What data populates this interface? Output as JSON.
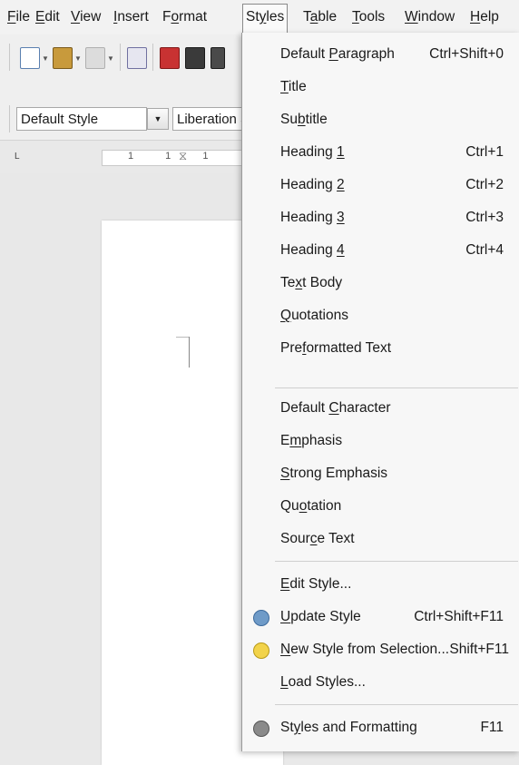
{
  "menubar": {
    "items": [
      {
        "pre": "",
        "u": "F",
        "post": "ile"
      },
      {
        "pre": "",
        "u": "E",
        "post": "dit"
      },
      {
        "pre": "",
        "u": "V",
        "post": "iew"
      },
      {
        "pre": "",
        "u": "I",
        "post": "nsert"
      },
      {
        "pre": "F",
        "u": "o",
        "post": "rmat"
      },
      {
        "pre": "St",
        "u": "y",
        "post": "les"
      },
      {
        "pre": "T",
        "u": "a",
        "post": "ble"
      },
      {
        "pre": "",
        "u": "T",
        "post": "ools"
      },
      {
        "pre": "",
        "u": "W",
        "post": "indow"
      },
      {
        "pre": "",
        "u": "H",
        "post": "elp"
      }
    ]
  },
  "toolbar": {
    "paragraph_style": "Default Style",
    "font_name": "Liberation S"
  },
  "ruler": {
    "marks": "1  1  1"
  },
  "styles_menu": {
    "items": [
      {
        "pre": "Default ",
        "u": "P",
        "post": "aragraph",
        "accel": "Ctrl+Shift+0",
        "icon": ""
      },
      {
        "pre": "",
        "u": "T",
        "post": "itle",
        "accel": "",
        "icon": ""
      },
      {
        "pre": "Su",
        "u": "b",
        "post": "title",
        "accel": "",
        "icon": ""
      },
      {
        "pre": "Heading ",
        "u": "1",
        "post": "",
        "accel": "Ctrl+1",
        "icon": ""
      },
      {
        "pre": "Heading ",
        "u": "2",
        "post": "",
        "accel": "Ctrl+2",
        "icon": ""
      },
      {
        "pre": "Heading ",
        "u": "3",
        "post": "",
        "accel": "Ctrl+3",
        "icon": ""
      },
      {
        "pre": "Heading ",
        "u": "4",
        "post": "",
        "accel": "Ctrl+4",
        "icon": ""
      },
      {
        "pre": "Te",
        "u": "x",
        "post": "t Body",
        "accel": "",
        "icon": ""
      },
      {
        "pre": "",
        "u": "Q",
        "post": "uotations",
        "accel": "",
        "icon": ""
      },
      {
        "pre": "Pre",
        "u": "f",
        "post": "ormatted Text",
        "accel": "",
        "icon": ""
      },
      {
        "pre": "Default ",
        "u": "C",
        "post": "haracter",
        "accel": "",
        "icon": ""
      },
      {
        "pre": "E",
        "u": "m",
        "post": "phasis",
        "accel": "",
        "icon": ""
      },
      {
        "pre": "",
        "u": "S",
        "post": "trong Emphasis",
        "accel": "",
        "icon": ""
      },
      {
        "pre": "Qu",
        "u": "o",
        "post": "tation",
        "accel": "",
        "icon": ""
      },
      {
        "pre": "Sour",
        "u": "c",
        "post": "e Text",
        "accel": "",
        "icon": ""
      },
      {
        "pre": "",
        "u": "E",
        "post": "dit Style...",
        "accel": "",
        "icon": ""
      },
      {
        "pre": "",
        "u": "U",
        "post": "pdate Style",
        "accel": "Ctrl+Shift+F11",
        "icon": "update-style-icon"
      },
      {
        "pre": "",
        "u": "N",
        "post": "ew Style from Selection...",
        "accel": "Shift+F11",
        "icon": "new-style-icon"
      },
      {
        "pre": "",
        "u": "L",
        "post": "oad Styles...",
        "accel": "",
        "icon": ""
      },
      {
        "pre": "St",
        "u": "y",
        "post": "les and Formatting",
        "accel": "F11",
        "icon": "styles-formatting-icon"
      }
    ]
  },
  "colors": {
    "menu_bg": "#f7f7f7",
    "update_icon": "#6f9bc8",
    "new_style_icon": "#f2d34a",
    "styles_formatting_icon": "#8a8a8a"
  }
}
